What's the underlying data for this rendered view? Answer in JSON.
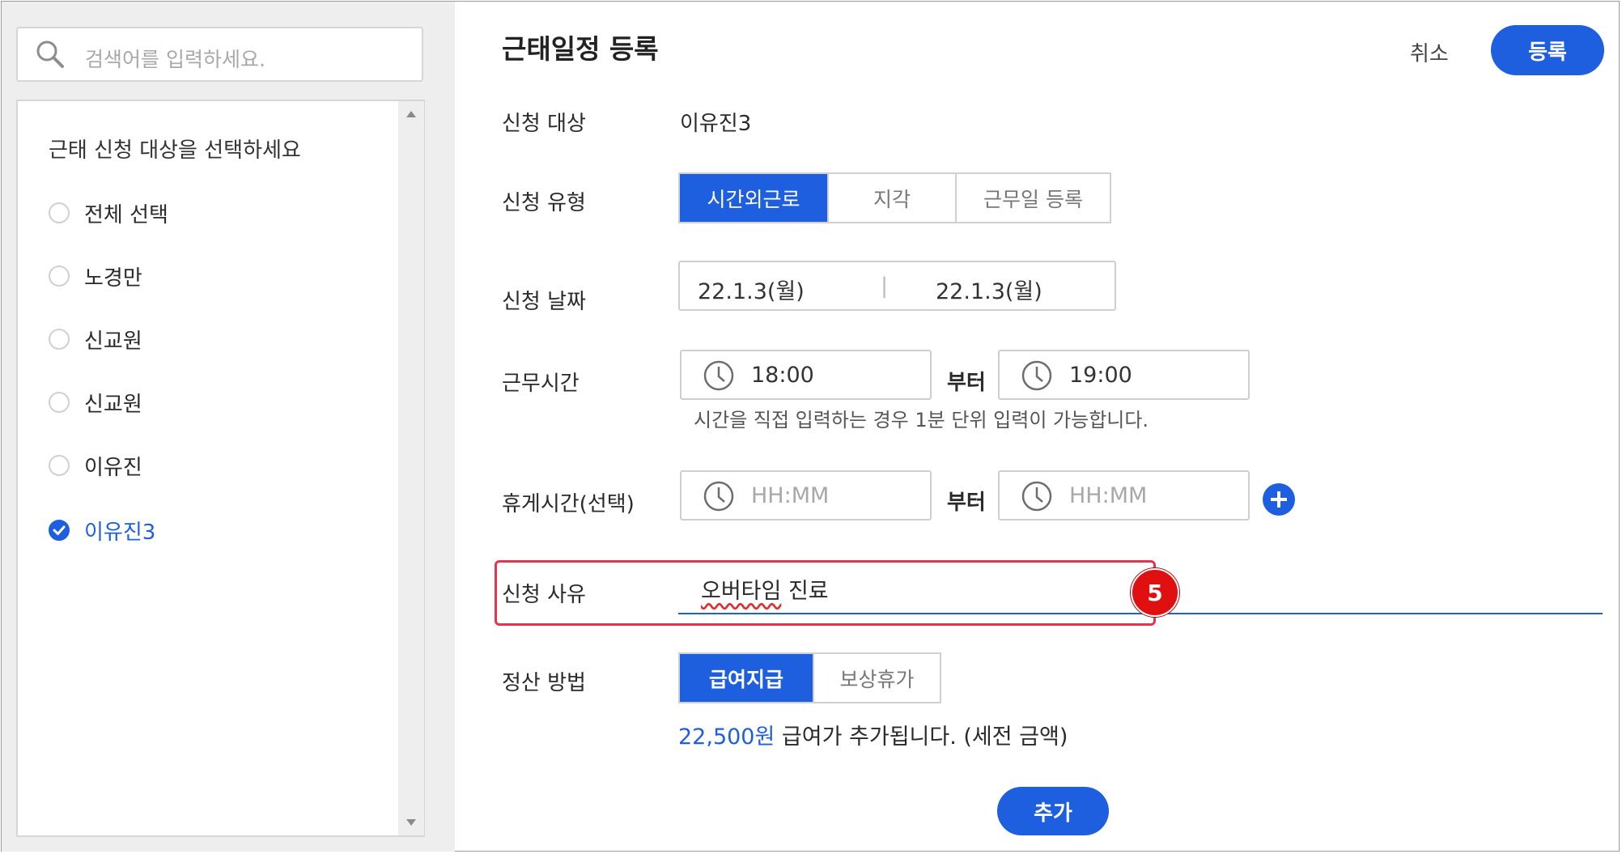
{
  "search": {
    "placeholder": "검색어를 입력하세요."
  },
  "target_list": {
    "heading": "근태 신청 대상을 선택하세요",
    "items": [
      {
        "label": "전체 선택",
        "selected": false
      },
      {
        "label": "노경만",
        "selected": false
      },
      {
        "label": "신교원",
        "selected": false
      },
      {
        "label": "신교원",
        "selected": false
      },
      {
        "label": "이유진",
        "selected": false
      },
      {
        "label": "이유진3",
        "selected": true
      }
    ]
  },
  "header": {
    "title": "근태일정 등록",
    "cancel_label": "취소",
    "register_label": "등록"
  },
  "form": {
    "target": {
      "label": "신청 대상",
      "value": "이유진3"
    },
    "type": {
      "label": "신청 유형",
      "options": [
        "시간외근로",
        "지각",
        "근무일 등록"
      ],
      "selected": "시간외근로"
    },
    "date": {
      "label": "신청 날짜",
      "start": "22.1.3(월)",
      "separator": "|",
      "end": "22.1.3(월)"
    },
    "work_time": {
      "label": "근무시간",
      "start": "18:00",
      "from_label": "부터",
      "end": "19:00",
      "note": "시간을 직접 입력하는 경우 1분 단위 입력이 가능합니다."
    },
    "break_time": {
      "label": "휴게시간(선택)",
      "start_placeholder": "HH:MM",
      "from_label": "부터",
      "end_placeholder": "HH:MM"
    },
    "reason": {
      "label": "신청 사유",
      "value_part1": "오버타임",
      "value_part2": " 진료"
    },
    "settlement": {
      "label": "정산 방법",
      "options": [
        "급여지급",
        "보상휴가"
      ],
      "selected": "급여지급",
      "amount": "22,500원",
      "amount_text": " 급여가 추가됩니다. (세전 금액)"
    }
  },
  "annotation_badge": "5",
  "add_button": "추가",
  "colors": {
    "accent": "#1e5fe0",
    "highlight": "#e5344e",
    "badge": "#e01010"
  }
}
